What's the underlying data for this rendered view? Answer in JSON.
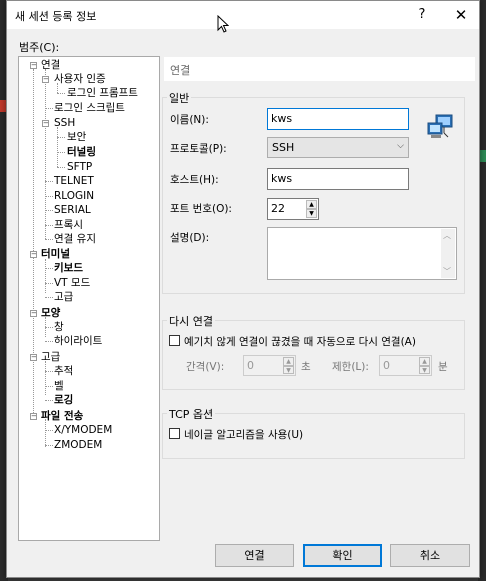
{
  "window": {
    "title": "새 세션 등록 정보",
    "help_glyph": "?",
    "close_glyph": "✕"
  },
  "category_label": "범주(C):",
  "tree": [
    {
      "label": "연결",
      "bold": true
    },
    {
      "label": "사용자 인증",
      "bold": true
    },
    {
      "label": "로그인 프롬프트",
      "bold": false
    },
    {
      "label": "로그인 스크립트",
      "bold": false
    },
    {
      "label": "SSH",
      "bold": false
    },
    {
      "label": "보안",
      "bold": false
    },
    {
      "label": "터널링",
      "bold": true
    },
    {
      "label": "SFTP",
      "bold": false
    },
    {
      "label": "TELNET",
      "bold": false
    },
    {
      "label": "RLOGIN",
      "bold": false
    },
    {
      "label": "SERIAL",
      "bold": false
    },
    {
      "label": "프록시",
      "bold": false
    },
    {
      "label": "연결 유지",
      "bold": false
    },
    {
      "label": "터미널",
      "bold": true
    },
    {
      "label": "키보드",
      "bold": true
    },
    {
      "label": "VT 모드",
      "bold": false
    },
    {
      "label": "고급",
      "bold": false
    },
    {
      "label": "모양",
      "bold": true
    },
    {
      "label": "창",
      "bold": false
    },
    {
      "label": "하이라이트",
      "bold": false
    },
    {
      "label": "고급",
      "bold": false
    },
    {
      "label": "추적",
      "bold": false
    },
    {
      "label": "벨",
      "bold": false
    },
    {
      "label": "로깅",
      "bold": true
    },
    {
      "label": "파일 전송",
      "bold": true
    },
    {
      "label": "X/YMODEM",
      "bold": false
    },
    {
      "label": "ZMODEM",
      "bold": false
    }
  ],
  "panel_title": "연결",
  "general": {
    "group_title": "일반",
    "name_label": "이름(N):",
    "name_value": "kws",
    "protocol_label": "프로토콜(P):",
    "protocol_value": "SSH",
    "host_label": "호스트(H):",
    "host_value": "kws",
    "port_label": "포트 번호(O):",
    "port_value": "22",
    "desc_label": "설명(D):",
    "desc_value": ""
  },
  "reconnect": {
    "group_title": "다시 연결",
    "checkbox_label": "예기치 않게 연결이 끊겼을 때 자동으로 다시 연결(A)",
    "checked": false,
    "interval_label": "간격(V):",
    "interval_value": "0",
    "interval_unit": "초",
    "limit_label": "제한(L):",
    "limit_value": "0",
    "limit_unit": "분"
  },
  "tcp": {
    "group_title": "TCP 옵션",
    "nagle_label": "네이글 알고리즘을 사용(U)",
    "checked": false
  },
  "buttons": {
    "connect": "연결",
    "ok": "확인",
    "cancel": "취소"
  },
  "colors": {
    "accent": "#0078d7",
    "dialog_bg": "#f0f0f0"
  }
}
